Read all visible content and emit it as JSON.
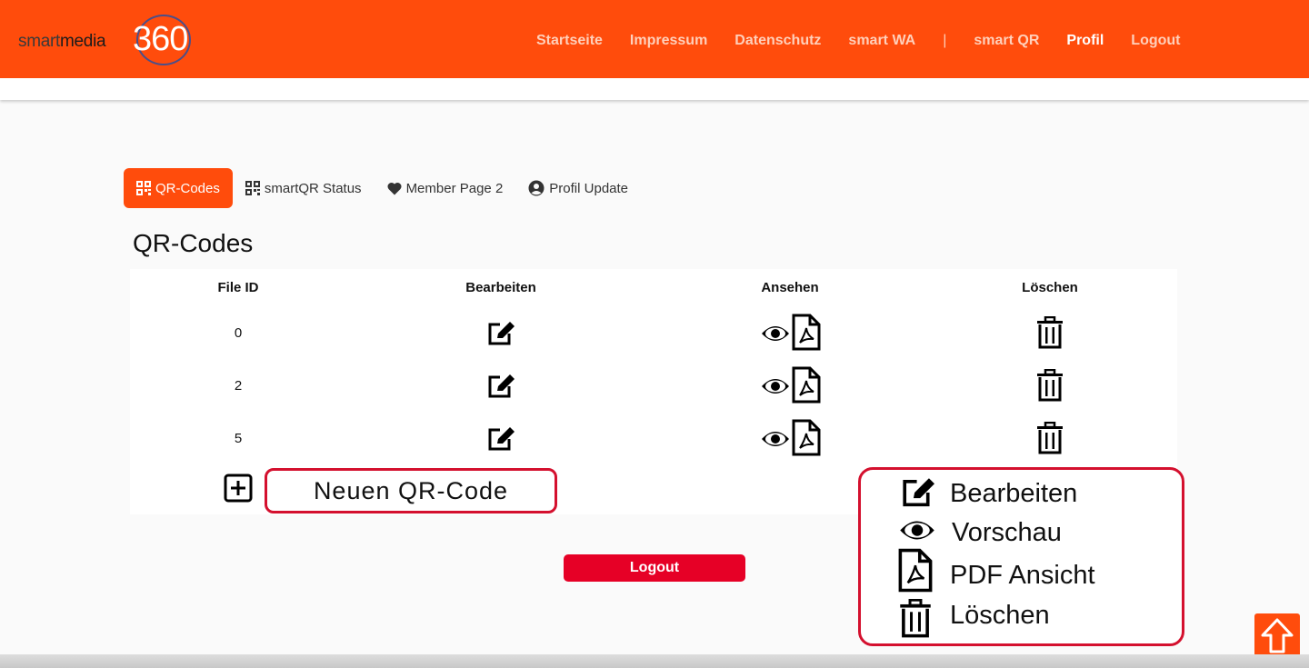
{
  "logo": {
    "part1": "smart",
    "part2": "media",
    "part3": "360"
  },
  "nav": {
    "items": [
      "Startseite",
      "Impressum",
      "Datenschutz",
      "smart WA",
      "|",
      "smart QR",
      "Profil",
      "Logout"
    ],
    "active": "Profil"
  },
  "tabs": [
    {
      "label": "QR-Codes",
      "icon": "qrcode-icon",
      "active": true
    },
    {
      "label": "smartQR Status",
      "icon": "qrcode-icon",
      "active": false
    },
    {
      "label": "Member Page 2",
      "icon": "heart-icon",
      "active": false
    },
    {
      "label": "Profil Update",
      "icon": "user-circle-icon",
      "active": false
    }
  ],
  "page_title": "QR-Codes",
  "table": {
    "headers": [
      "File ID",
      "Bearbeiten",
      "Ansehen",
      "Löschen"
    ],
    "rows": [
      {
        "file_id": "0"
      },
      {
        "file_id": "2"
      },
      {
        "file_id": "5"
      }
    ]
  },
  "new_qr_label": "Neuen QR-Code",
  "legend": {
    "edit": "Bearbeiten",
    "preview": "Vorschau",
    "pdf": "PDF Ansicht",
    "delete": "Löschen"
  },
  "logout_button": "Logout",
  "colors": {
    "brand_orange": "#ff4c0c",
    "accent_red": "#e60026",
    "callout_border": "#d4102e"
  }
}
